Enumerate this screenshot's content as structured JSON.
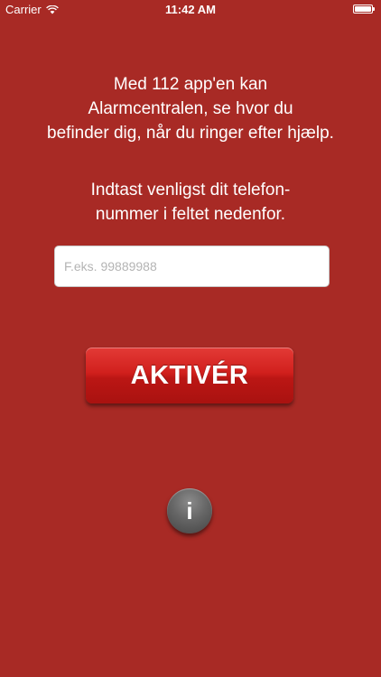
{
  "status_bar": {
    "carrier": "Carrier",
    "time": "11:42 AM",
    "icons": [
      "wifi-icon",
      "battery-icon"
    ]
  },
  "intro_lines": [
    "Med 112 app'en kan",
    "Alarmcentralen, se hvor du",
    "befinder dig, når du ringer efter hjælp."
  ],
  "instruction_lines": [
    "Indtast venligst dit telefon-",
    "nummer i feltet nedenfor."
  ],
  "phone_input": {
    "value": "",
    "placeholder": "F.eks. 99889988"
  },
  "activate_button": {
    "label": "AKTIVÉR"
  },
  "info_button": {
    "glyph": "i",
    "icon": "info-icon"
  },
  "colors": {
    "background": "#a82a25",
    "button_red": "#d1201d",
    "info_grey": "#666666"
  }
}
